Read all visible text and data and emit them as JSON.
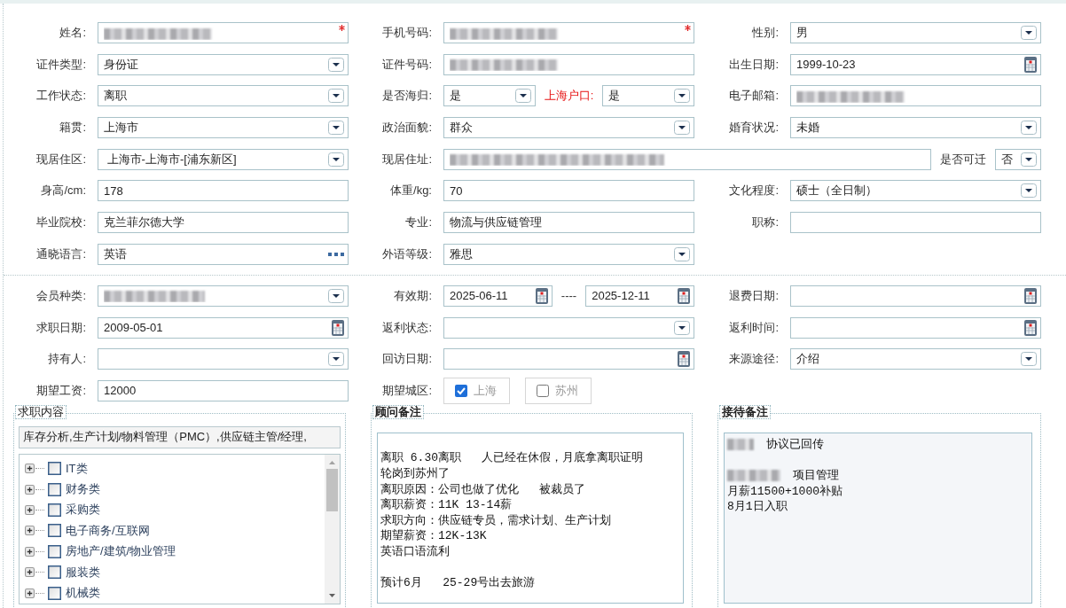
{
  "sections": [
    {
      "rows": [
        {
          "cells": [
            {
              "label": "姓名:",
              "items": [
                {
                  "kind": "text",
                  "redacted": true,
                  "required": true
                }
              ]
            },
            {
              "label": "手机号码:",
              "items": [
                {
                  "kind": "text",
                  "redacted": true,
                  "required": true
                }
              ]
            },
            {
              "label": "性别:",
              "items": [
                {
                  "kind": "select",
                  "value": "男"
                }
              ]
            }
          ]
        },
        {
          "cells": [
            {
              "label": "证件类型:",
              "items": [
                {
                  "kind": "select",
                  "value": "身份证"
                }
              ]
            },
            {
              "label": "证件号码:",
              "items": [
                {
                  "kind": "text",
                  "redacted": true
                }
              ]
            },
            {
              "label": "出生日期:",
              "items": [
                {
                  "kind": "date",
                  "value": "1999-10-23"
                }
              ]
            }
          ]
        },
        {
          "cells": [
            {
              "label": "工作状态:",
              "items": [
                {
                  "kind": "select",
                  "value": "离职"
                }
              ]
            },
            {
              "label": "是否海归:",
              "items": [
                {
                  "kind": "select",
                  "value": "是"
                },
                {
                  "kind": "label",
                  "text": "上海户口:",
                  "emphasis": true
                },
                {
                  "kind": "select",
                  "value": "是"
                }
              ]
            },
            {
              "label": "电子邮箱:",
              "items": [
                {
                  "kind": "text",
                  "redacted": true
                }
              ]
            }
          ]
        },
        {
          "cells": [
            {
              "label": "籍贯:",
              "items": [
                {
                  "kind": "select",
                  "value": "上海市"
                }
              ]
            },
            {
              "label": "政治面貌:",
              "items": [
                {
                  "kind": "select",
                  "value": "群众"
                }
              ]
            },
            {
              "label": "婚育状况:",
              "items": [
                {
                  "kind": "select",
                  "value": "未婚"
                }
              ]
            }
          ]
        },
        {
          "cells": [
            {
              "label": "现居住区:",
              "items": [
                {
                  "kind": "select",
                  "value": " 上海市-上海市-[浦东新区]"
                }
              ]
            },
            {
              "label": "现居住址:",
              "wide": true,
              "items": [
                {
                  "kind": "text",
                  "redacted": true
                },
                {
                  "kind": "label",
                  "text": "是否可迁",
                  "emphasis": false
                },
                {
                  "kind": "select",
                  "value": "否"
                }
              ]
            }
          ]
        },
        {
          "cells": [
            {
              "label": "身高/cm:",
              "items": [
                {
                  "kind": "text",
                  "value": "178"
                }
              ]
            },
            {
              "label": "体重/kg:",
              "items": [
                {
                  "kind": "text",
                  "value": "70"
                }
              ]
            },
            {
              "label": "文化程度:",
              "items": [
                {
                  "kind": "select",
                  "value": "硕士（全日制）"
                }
              ]
            }
          ]
        },
        {
          "cells": [
            {
              "label": "毕业院校:",
              "items": [
                {
                  "kind": "text",
                  "value": "克兰菲尔德大学"
                }
              ]
            },
            {
              "label": "专业:",
              "items": [
                {
                  "kind": "text",
                  "value": "物流与供应链管理"
                }
              ]
            },
            {
              "label": "职称:",
              "items": [
                {
                  "kind": "text"
                }
              ]
            }
          ]
        },
        {
          "cells": [
            {
              "label": "通晓语言:",
              "items": [
                {
                  "kind": "picker",
                  "value": "英语"
                }
              ]
            },
            {
              "label": "外语等级:",
              "items": [
                {
                  "kind": "select",
                  "value": "雅思"
                }
              ]
            }
          ]
        }
      ]
    },
    {
      "rows": [
        {
          "cells": [
            {
              "label": "会员种类:",
              "items": [
                {
                  "kind": "select",
                  "redacted": true
                }
              ]
            },
            {
              "label": "有效期:",
              "items": [
                {
                  "kind": "date",
                  "value": "2025-06-11"
                },
                {
                  "kind": "label",
                  "text": "----",
                  "emphasis": false
                },
                {
                  "kind": "date",
                  "value": "2025-12-11"
                }
              ]
            },
            {
              "label": "退费日期:",
              "items": [
                {
                  "kind": "date"
                }
              ]
            }
          ]
        },
        {
          "cells": [
            {
              "label": "求职日期:",
              "items": [
                {
                  "kind": "date",
                  "value": "2009-05-01"
                }
              ]
            },
            {
              "label": "返利状态:",
              "items": [
                {
                  "kind": "select"
                }
              ]
            },
            {
              "label": "返利时间:",
              "items": [
                {
                  "kind": "date"
                }
              ]
            }
          ]
        },
        {
          "cells": [
            {
              "label": "持有人:",
              "items": [
                {
                  "kind": "select"
                }
              ]
            },
            {
              "label": "回访日期:",
              "items": [
                {
                  "kind": "date"
                }
              ]
            },
            {
              "label": "来源途径:",
              "items": [
                {
                  "kind": "select",
                  "value": "介绍"
                }
              ]
            }
          ]
        },
        {
          "cells": [
            {
              "label": "期望工资:",
              "items": [
                {
                  "kind": "text",
                  "value": "12000"
                }
              ]
            },
            {
              "label": "期望城区:",
              "items": [
                {
                  "kind": "checkbox",
                  "text": "上海",
                  "checked": true
                },
                {
                  "kind": "checkbox",
                  "text": "苏州",
                  "checked": false
                }
              ]
            }
          ]
        }
      ]
    }
  ],
  "panels": [
    {
      "kind": "tree",
      "title": "求职内容",
      "bold": false,
      "summary": "库存分析,生产计划/物料管理（PMC）,供应链主管/经理,",
      "items": [
        {
          "label": "IT类",
          "checked": false,
          "expanded": false
        },
        {
          "label": "财务类",
          "checked": false,
          "expanded": false
        },
        {
          "label": "采购类",
          "checked": false,
          "expanded": false
        },
        {
          "label": "电子商务/互联网",
          "checked": false,
          "expanded": false
        },
        {
          "label": "房地产/建筑/物业管理",
          "checked": false,
          "expanded": false
        },
        {
          "label": "服装类",
          "checked": false,
          "expanded": false
        },
        {
          "label": "机械类",
          "checked": false,
          "expanded": false
        }
      ]
    },
    {
      "kind": "lines",
      "title": "顾问备注",
      "bold": true,
      "readonly": false,
      "lines": [
        {
          "text": "离职 6.30离职   人已经在休假，月底拿离职证明",
          "space_before": true
        },
        {
          "text": "轮岗到苏州了",
          "space_before": false
        },
        {
          "text": "离职原因：公司也做了优化   被裁员了",
          "space_before": false
        },
        {
          "text": "离职薪资：11K 13-14薪",
          "space_before": false
        },
        {
          "text": "求职方向：供应链专员，需求计划、生产计划",
          "space_before": false
        },
        {
          "text": "期望薪资：12K-13K",
          "space_before": false
        },
        {
          "text": "英语口语流利",
          "space_before": false
        },
        {
          "text": "预计6月   25-29号出去旅游",
          "space_before": true
        }
      ]
    },
    {
      "kind": "lines",
      "title": "接待备注",
      "bold": true,
      "readonly": true,
      "lines": [
        {
          "redacted": true,
          "text": "协议已回传",
          "space_before": false
        },
        {
          "redacted": true,
          "text": "项目管理",
          "space_before": true
        },
        {
          "text": "月薪11500+1000补贴",
          "space_before": false
        },
        {
          "text": "8月1日入职",
          "space_before": false
        }
      ]
    }
  ]
}
